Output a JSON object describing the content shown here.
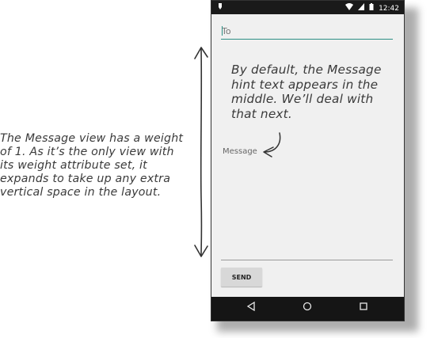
{
  "annotations": {
    "left_note": "The Message view has a weight\nof 1. As it’s the only view with\nits weight attribute set, it\nexpands to take up any extra\nvertical space in the layout.",
    "phone_note": "By default, the Message\nhint text appears in the\nmiddle. We’ll deal with\nthat next."
  },
  "status_bar": {
    "time": "12:42",
    "left_icon": "notification-icon",
    "wifi_icon": "wifi-icon",
    "signal_icon": "signal-icon",
    "battery_icon": "battery-icon"
  },
  "form": {
    "to_placeholder": "To",
    "message_hint": "Message",
    "send_label": "SEND"
  },
  "nav": {
    "back_icon": "back-icon",
    "home_icon": "home-icon",
    "recents_icon": "recents-icon"
  },
  "colors": {
    "accent": "#2d8f84",
    "phone_background": "#f0f0f0",
    "bars": "#151515"
  }
}
